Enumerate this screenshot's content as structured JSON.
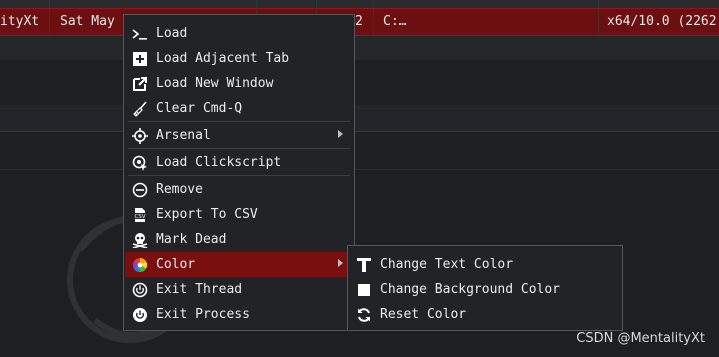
{
  "table": {
    "selected_row": {
      "user": "ityXt",
      "date": "Sat May",
      "partial_num": "2",
      "path": "C:…",
      "arch": "x64/10.0 (2262"
    }
  },
  "context_menu": {
    "items": [
      {
        "label": "Load",
        "icon": "terminal-icon"
      },
      {
        "label": "Load Adjacent Tab",
        "icon": "add-tab-icon"
      },
      {
        "label": "Load New Window",
        "icon": "external-window-icon"
      },
      {
        "label": "Clear Cmd-Q",
        "icon": "broom-icon"
      },
      {
        "label": "Arsenal",
        "icon": "crosshair-icon"
      },
      {
        "label": "Load Clickscript",
        "icon": "clickscript-icon"
      },
      {
        "label": "Remove",
        "icon": "minus-circle-icon"
      },
      {
        "label": "Export To CSV",
        "icon": "csv-icon"
      },
      {
        "label": "Mark Dead",
        "icon": "skull-icon"
      },
      {
        "label": "Color",
        "icon": "color-wheel-icon"
      },
      {
        "label": "Exit Thread",
        "icon": "power-icon"
      },
      {
        "label": "Exit Process",
        "icon": "power-filled-icon"
      }
    ]
  },
  "color_submenu": {
    "items": [
      {
        "label": "Change Text Color",
        "icon": "text-t-icon"
      },
      {
        "label": "Change Background Color",
        "icon": "square-icon"
      },
      {
        "label": "Reset Color",
        "icon": "refresh-icon"
      }
    ]
  },
  "watermark": "CSDN @MentalityXt",
  "colors": {
    "highlight": "#7a0f10",
    "selected_row": "#6b0f10",
    "menu_bg": "#222327",
    "background": "#1e1f22"
  }
}
